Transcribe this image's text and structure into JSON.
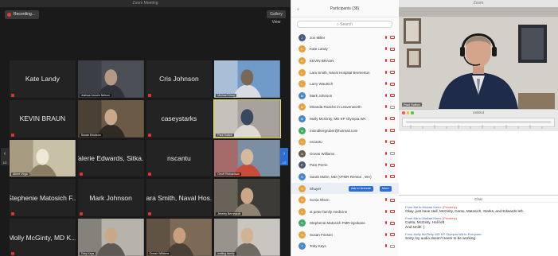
{
  "gallery": {
    "window_title": "Zoom Meeting",
    "recording_label": "Recording...",
    "view_button": "Gallery View",
    "page_left": "1/2",
    "page_right": "1/2",
    "tiles": [
      {
        "kind": "name",
        "name": "Kate Landy"
      },
      {
        "kind": "video",
        "label": "Joshua Lincoln Nelson",
        "palette": [
          "#4b4f55",
          "#2f3238",
          "#b59a83"
        ]
      },
      {
        "kind": "name",
        "name": "Cris Johnson"
      },
      {
        "kind": "video",
        "label": "Michael Keen",
        "palette": [
          "#6f9ac9",
          "#d9dde2",
          "#7a6756"
        ]
      },
      {
        "kind": "name",
        "name": "KEVIN BRAUN"
      },
      {
        "kind": "video",
        "label": "Susan Erickson",
        "palette": [
          "#6b5b46",
          "#2f2a24",
          "#c7a98c"
        ]
      },
      {
        "kind": "name",
        "name": "caseystarks"
      },
      {
        "kind": "video",
        "label": "Paul Sutton",
        "palette": [
          "#a7a39c",
          "#dedbd5",
          "#39485e"
        ],
        "active": true
      },
      {
        "kind": "video",
        "label": "Albert Vega",
        "palette": [
          "#c9c0a8",
          "#8a7d62",
          "#efe8d6"
        ]
      },
      {
        "kind": "name",
        "name": "Valerie Edwards, Sitka..."
      },
      {
        "kind": "name",
        "name": "nscantu"
      },
      {
        "kind": "video",
        "label": "Geoff Richardson",
        "palette": [
          "#7a8fa3",
          "#c74c3a",
          "#d8b89c"
        ]
      },
      {
        "kind": "name",
        "name": "Stephenie Matosich F..."
      },
      {
        "kind": "name",
        "name": "Mark Johnson"
      },
      {
        "kind": "name",
        "name": "Lara Smith, Naval Hos..."
      },
      {
        "kind": "video",
        "label": "Jeremy Bernhardt",
        "palette": [
          "#3d3b38",
          "#8e8373",
          "#c9a787"
        ]
      },
      {
        "kind": "name",
        "name": "Molly McGinty, MD K..."
      },
      {
        "kind": "video",
        "label": "Toby Keys",
        "palette": [
          "#b7b3aa",
          "#5d5a54",
          "#c8a88b"
        ]
      },
      {
        "kind": "video",
        "label": "Ocean Williams",
        "palette": [
          "#7c6a56",
          "#4a4037",
          "#c8a07f"
        ]
      },
      {
        "kind": "video",
        "label": "welling family",
        "palette": [
          "#c9c6c0",
          "#6f6a62",
          "#d2b495"
        ]
      }
    ]
  },
  "participants": {
    "title": "Participants (38)",
    "search_placeholder": "Search",
    "unmute_label": "Ask to Unmute",
    "more_label": "More",
    "items": [
      {
        "name": "Jon Miller",
        "color": "#4a5a7a",
        "initial": "J",
        "mic": "off",
        "cam": "off"
      },
      {
        "name": "Kate Landy",
        "color": "#e8a23c",
        "initial": "K",
        "mic": "off",
        "cam": "off"
      },
      {
        "name": "KEVIN BRAUN",
        "color": "#e8a23c",
        "initial": "K",
        "mic": "off",
        "cam": "off"
      },
      {
        "name": "Lara Smith, Naval Hospital Bremerton",
        "color": "#e8a23c",
        "initial": "L",
        "mic": "off",
        "cam": "off"
      },
      {
        "name": "Larry Wautrich",
        "color": "#e8a23c",
        "initial": "L",
        "mic": "off",
        "cam": "off"
      },
      {
        "name": "Mark Johnson",
        "color": "#4a87c7",
        "initial": "M",
        "mic": "off",
        "cam": "off"
      },
      {
        "name": "Miranda Roache in Leavenworth",
        "color": "#e8a23c",
        "initial": "M",
        "mic": "off",
        "cam": "on"
      },
      {
        "name": "Molly McGinty, MD KP Olympia WA",
        "color": "#4a87c7",
        "initial": "M",
        "mic": "off",
        "cam": "off"
      },
      {
        "name": "msmdkergruber@hotmail.com",
        "color": "#3faa6a",
        "initial": "m",
        "mic": "off",
        "cam": "off"
      },
      {
        "name": "nscantu",
        "color": "#e8a23c",
        "initial": "n",
        "mic": "off",
        "cam": "off"
      },
      {
        "name": "Ocean Williams",
        "color": "#6a5a4a",
        "initial": "O",
        "mic": "off",
        "cam": "on"
      },
      {
        "name": "Pam Perrin",
        "color": "#4a5a6a",
        "initial": "P",
        "mic": "off",
        "cam": "off"
      },
      {
        "name": "Sarah Mahn, MD (VFMR Renton , WA)",
        "color": "#4a87c7",
        "initial": "S",
        "mic": "off",
        "cam": "off"
      },
      {
        "name": "Shuyer",
        "color": "#e8a23c",
        "initial": "S",
        "mic": "off",
        "cam": "off",
        "highlight": true
      },
      {
        "name": "Sonia Olsen",
        "color": "#e8a23c",
        "initial": "S",
        "mic": "off",
        "cam": "off"
      },
      {
        "name": "st peter family medicine",
        "color": "#e8a23c",
        "initial": "s",
        "mic": "off",
        "cam": "off"
      },
      {
        "name": "Stephenie Matosich FMR-Spokane",
        "color": "#3faa6a",
        "initial": "S",
        "mic": "off",
        "cam": "off"
      },
      {
        "name": "Susan Friesen",
        "color": "#e8a23c",
        "initial": "S",
        "mic": "off",
        "cam": "off"
      },
      {
        "name": "Toby Keys",
        "color": "#4a87c7",
        "initial": "T",
        "mic": "off",
        "cam": "on"
      }
    ]
  },
  "speaker": {
    "window_title": "Zoom",
    "name_label": "Paul Sutton"
  },
  "editor": {
    "title": "Untitled"
  },
  "chat": {
    "title": "Chat",
    "messages": [
      {
        "from": "From Me to Mickah Keen:",
        "tag": "(Privately)",
        "lines": [
          "Okay, just have Hall, McGinty, Cantu, Matosich, Starks, and Edwards left."
        ]
      },
      {
        "from": "From Me to Mickah Keen:",
        "tag": "(Privately)",
        "lines": [
          "Cantu, McGinty, Hall left",
          "And smith :)"
        ]
      },
      {
        "from": "From Molly McGinty, MD KP Olympia WA to Everyone:",
        "tag": "",
        "lines": [
          "Sorry my audio doesn't seem to be working"
        ]
      }
    ]
  }
}
